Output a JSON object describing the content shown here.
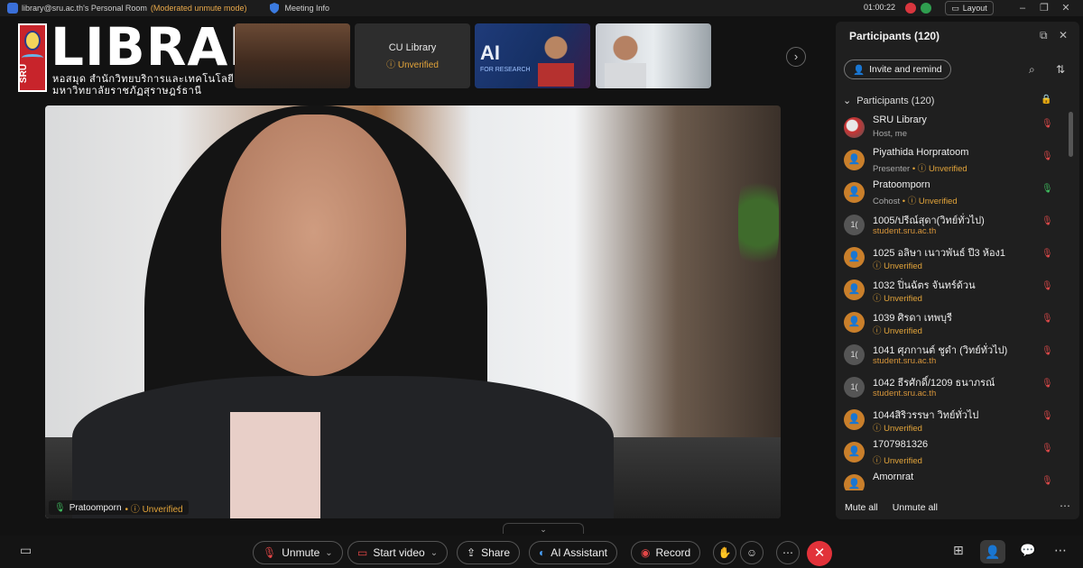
{
  "titlebar": {
    "room": "library@sru.ac.th's Personal Room",
    "moderated": "(Moderated unmute mode)",
    "meeting_info": "Meeting Info",
    "timer": "01:00:22",
    "layout": "Layout",
    "icons": [
      "webex-logo-icon",
      "shield-icon",
      "recording-icon",
      "check-icon",
      "layout-icon",
      "minimize-icon",
      "restore-icon",
      "close-icon"
    ]
  },
  "logo": {
    "mark": "SRU",
    "title": "LIBRARY",
    "subtitle1": "หอสมุด สำนักวิทยบริการและเทคโนโลยีสารสนเทศ",
    "subtitle2": "มหาวิทยาลัยราชภัฏสุราษฎร์ธานี"
  },
  "thumbnails": {
    "cu_name": "CU Library",
    "cu_status": "Unverified",
    "ai_text": "AI",
    "ai_sub": "FOR RESEARCH"
  },
  "main_video": {
    "name": "Pratoomporn",
    "status": "Unverified"
  },
  "panel": {
    "title": "Participants (120)",
    "invite": "Invite and remind",
    "group": "Participants (120)",
    "mute_all": "Mute all",
    "unmute_all": "Unmute all",
    "participants": [
      {
        "name": "SRU Library",
        "role": "Host, me",
        "status": "",
        "avatar": "",
        "mic": "muted"
      },
      {
        "name": "Piyathida Horpratoom",
        "role": "Presenter",
        "status": "Unverified",
        "avatar": "",
        "mic": "muted"
      },
      {
        "name": "Pratoomporn",
        "role": "Cohost",
        "status": "Unverified",
        "avatar": "",
        "mic": "on"
      },
      {
        "name": "1005/ปรีณ์สุดา(วิทย์ทั่วไป)",
        "role": "student.sru.ac.th",
        "status": "",
        "avatar": "1(",
        "mic": "muted"
      },
      {
        "name": "1025  อลิษา  เนาวพันธ์  ปี3  ห้อง1",
        "role": "",
        "status": "Unverified",
        "avatar": "",
        "mic": "muted"
      },
      {
        "name": "1032 ปิ่นฉัตร จันทร์ด้วน",
        "role": "",
        "status": "Unverified",
        "avatar": "",
        "mic": "muted"
      },
      {
        "name": "1039 ศิรดา เทพบุรี",
        "role": "",
        "status": "Unverified",
        "avatar": "",
        "mic": "muted"
      },
      {
        "name": "1041 ศุภกานต์ ชูดำ (วิทย์ทั่วไป)",
        "role": "student.sru.ac.th",
        "status": "",
        "avatar": "1(",
        "mic": "muted"
      },
      {
        "name": "1042 ธีรศักดิ์/1209 ธนาภรณ์",
        "role": "student.sru.ac.th",
        "status": "",
        "avatar": "1(",
        "mic": "muted"
      },
      {
        "name": "1044สิริวรรษา วิทย์ทั่วไป",
        "role": "",
        "status": "Unverified",
        "avatar": "",
        "mic": "muted"
      },
      {
        "name": "1707981326",
        "role": "",
        "status": "Unverified",
        "avatar": "",
        "mic": "muted"
      },
      {
        "name": "Amornrat",
        "role": "",
        "status": "",
        "avatar": "",
        "mic": "muted"
      }
    ]
  },
  "toolbar": {
    "unmute": "Unmute",
    "start_video": "Start video",
    "share": "Share",
    "ai_assistant": "AI Assistant",
    "record": "Record"
  },
  "colors": {
    "accent_orange": "#e2a43a",
    "mic_muted": "#e04a4a",
    "mic_on": "#3fbf5f",
    "leave_red": "#e2323a",
    "logo_red": "#c8242b"
  }
}
